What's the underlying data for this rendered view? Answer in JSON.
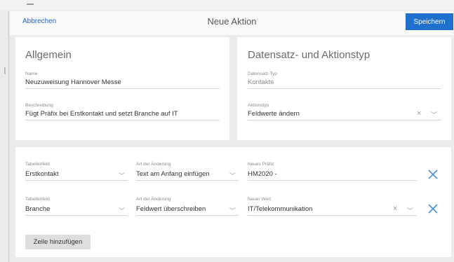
{
  "header": {
    "cancel_label": "Abbrechen",
    "title": "Neue Aktion",
    "save_label": "Speichern"
  },
  "general": {
    "title": "Allgemein",
    "name_label": "Name",
    "name_value": "Neuzuweisung Hannover Messe",
    "description_label": "Beschreibung",
    "description_value": "Fügt Präfix bei Erstkontakt und setzt Branche auf IT"
  },
  "record_type": {
    "title": "Datensatz- und Aktionstyp",
    "record_type_label": "Datensatz-Typ",
    "record_type_value": "Kontakte",
    "action_type_label": "Aktionstyp",
    "action_type_value": "Feldwerte ändern"
  },
  "rows": [
    {
      "field_label": "Tabellenfeld",
      "field_value": "Erstkontakt",
      "change_label": "Art der Änderung",
      "change_value": "Text am Anfang einfügen",
      "value_label": "Neues Präfix",
      "value_value": "HM2020 -"
    },
    {
      "field_label": "Tabellenfeld",
      "field_value": "Branche",
      "change_label": "Art der Änderung",
      "change_value": "Feldwert überschreiben",
      "value_label": "Neuer Wert",
      "value_value": "IT/Telekommunikation"
    }
  ],
  "add_row_label": "Zeile hinzufügen",
  "colors": {
    "accent": "#1f6fcc",
    "link": "#1f64c9",
    "remove_icon": "#4a90d9"
  }
}
